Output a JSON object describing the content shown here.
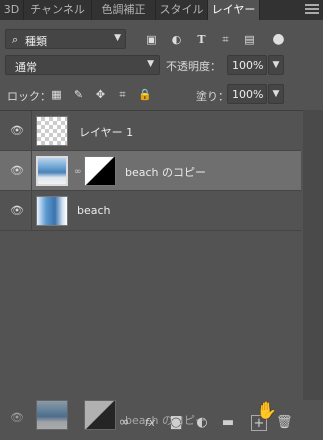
{
  "tabs": [
    "3D",
    "チャンネル",
    "色調補正",
    "スタイル",
    "レイヤー"
  ],
  "active_tab": 4,
  "filter": {
    "label": "種類"
  },
  "blend": {
    "mode": "通常"
  },
  "opacity": {
    "label": "不透明度：",
    "value": "100%"
  },
  "lock": {
    "label": "ロック："
  },
  "fill": {
    "label": "塗り：",
    "value": "100%"
  },
  "layers": [
    {
      "name": "レイヤー 1",
      "visible": true,
      "selected": false
    },
    {
      "name": "beach のコピー",
      "visible": true,
      "selected": true
    },
    {
      "name": "beach",
      "visible": true,
      "selected": false
    }
  ],
  "drag_ghost": {
    "name": "beach のコピー"
  },
  "icons": {
    "filter_types": [
      "image-filter-icon",
      "adjustment-filter-icon",
      "type-filter-icon",
      "shape-filter-icon",
      "smart-object-filter-icon",
      "filter-toggle-icon"
    ],
    "locks": [
      "lock-transparent-icon",
      "lock-paint-icon",
      "lock-position-icon",
      "lock-artboard-icon",
      "lock-all-icon"
    ],
    "bottom": [
      "link-icon",
      "fx-icon",
      "mask-icon",
      "adjustment-icon",
      "folder-icon",
      "new-layer-icon",
      "trash-icon"
    ]
  }
}
